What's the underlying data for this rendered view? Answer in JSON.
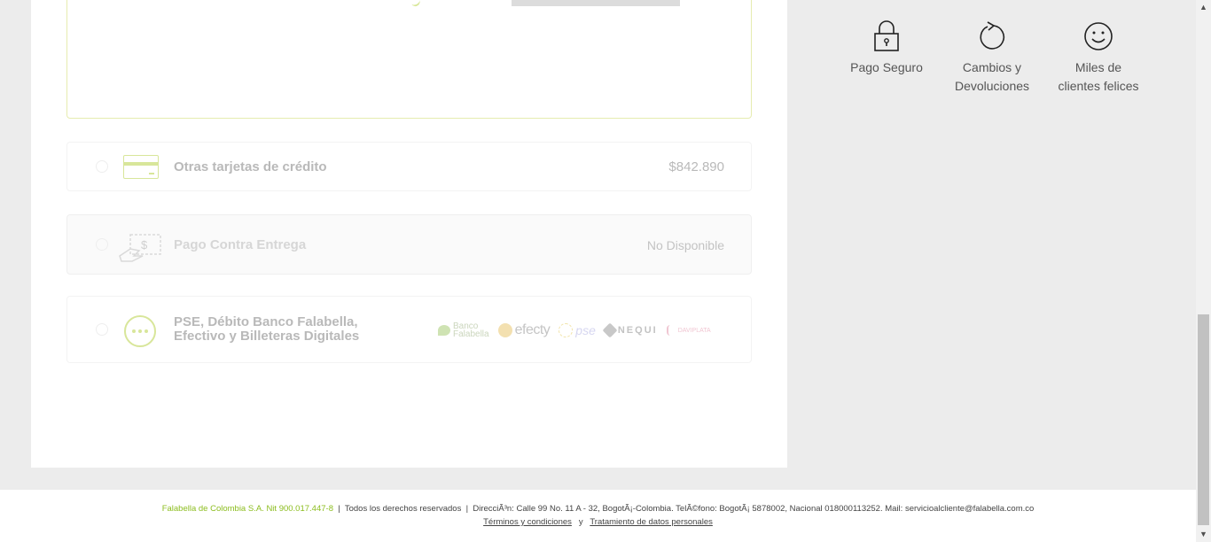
{
  "payment_options": [
    {
      "label": "Otras tarjetas de crédito",
      "right": "$842.890",
      "icon": "credit-card-icon"
    },
    {
      "label": "Pago Contra Entrega",
      "right": "No Disponible",
      "icon": "cash-delivery-icon"
    },
    {
      "label_line1": "PSE, Débito Banco Falabella,",
      "label_line2": "Efectivo y Billeteras Digitales",
      "icon": "more-dots-icon",
      "logos": {
        "banco_line1": "Banco",
        "banco_line2": "Falabella",
        "efecty": "efecty",
        "pse": "pse",
        "nequi": "NEQUI",
        "daviplata": "DAVIPLATA"
      }
    }
  ],
  "features": [
    {
      "line1": "Pago Seguro",
      "line2": "",
      "icon": "lock-icon"
    },
    {
      "line1": "Cambios y",
      "line2": "Devoluciones",
      "icon": "return-arrow-icon"
    },
    {
      "line1": "Miles de",
      "line2": "clientes felices",
      "icon": "smiley-icon"
    }
  ],
  "footer": {
    "brand": "Falabella de Colombia S.A. Nit 900.017.447-8",
    "separator": "|",
    "rights": "Todos los derechos reservados",
    "address": "DirecciÃ³n: Calle 99 No. 11 A - 32, BogotÃ¡-Colombia. TelÃ©fono: BogotÃ¡ 5878002, Nacional 018000113252. Mail: servicioalcliente@falabella.com.co",
    "terms_link": "Términos y condiciones",
    "conjunction": "y",
    "privacy_link": "Tratamiento de datos personales"
  },
  "colors": {
    "accent": "#8cbd1f",
    "muted_icon": "#d8e69a",
    "background": "#ececec"
  }
}
